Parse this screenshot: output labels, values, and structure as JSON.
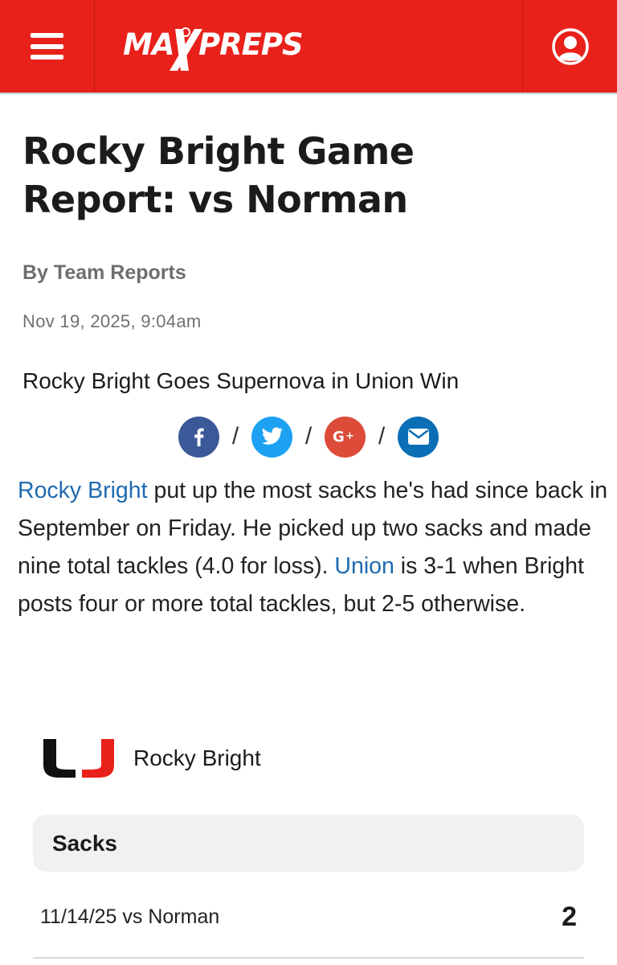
{
  "header": {
    "logo_text": "MAXPREPS",
    "icons": [
      "hamburger-menu-icon",
      "user-account-icon"
    ],
    "bar_color": "#e8211a"
  },
  "article": {
    "headline": "Rocky Bright Game Report: vs Norman",
    "byline": "By Team Reports",
    "date": "Nov 19, 2025, 9:04am",
    "subheadline": "Rocky Bright Goes Supernova in Union Win",
    "share": {
      "separator": "/",
      "buttons": [
        {
          "icon": "facebook-icon",
          "color": "#3b5998"
        },
        {
          "icon": "twitter-icon",
          "color": "#1da1f2"
        },
        {
          "icon": "google-plus-icon",
          "color": "#dd4b39"
        },
        {
          "icon": "email-icon",
          "color": "#0a6fb5"
        }
      ]
    },
    "body": {
      "player_link": "Rocky Bright",
      "text_1": " put up the most sacks he's had since back in September on Friday. He picked up two sacks and made nine total tackles (4.0 for loss). ",
      "team_link": "Union",
      "text_2": " is 3-1 when Bright posts four or more total tackles, but 2-5 otherwise.",
      "link_color": "#1f6ab0"
    }
  },
  "player_card": {
    "name": "Rocky Bright",
    "logo_icon": "union-u-logo-icon"
  },
  "stats": {
    "category": "Sacks",
    "rows": [
      {
        "game": "11/14/25 vs Norman",
        "value": "2"
      }
    ]
  }
}
